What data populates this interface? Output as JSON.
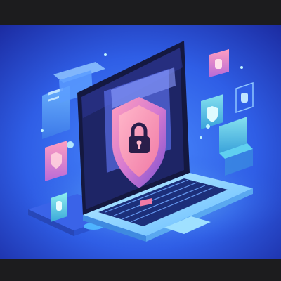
{
  "scene": {
    "subject": "laptop-with-security-shield",
    "colors": {
      "background_dark": "#1c1c1e",
      "backdrop_center": "#3f7dff",
      "backdrop_edge": "#1a2a9a",
      "glow": "#4fc3ff",
      "shield_pink": "#ff8fb0",
      "shield_purple": "#9a5bd6",
      "laptop_body": "#8fd6ff",
      "screen_dark": "#1a1d4a"
    },
    "icons": [
      "shield-lock-icon",
      "padlock-icon",
      "floating-app-card-icon",
      "floating-shield-card-icon",
      "keyboard-icon"
    ]
  }
}
